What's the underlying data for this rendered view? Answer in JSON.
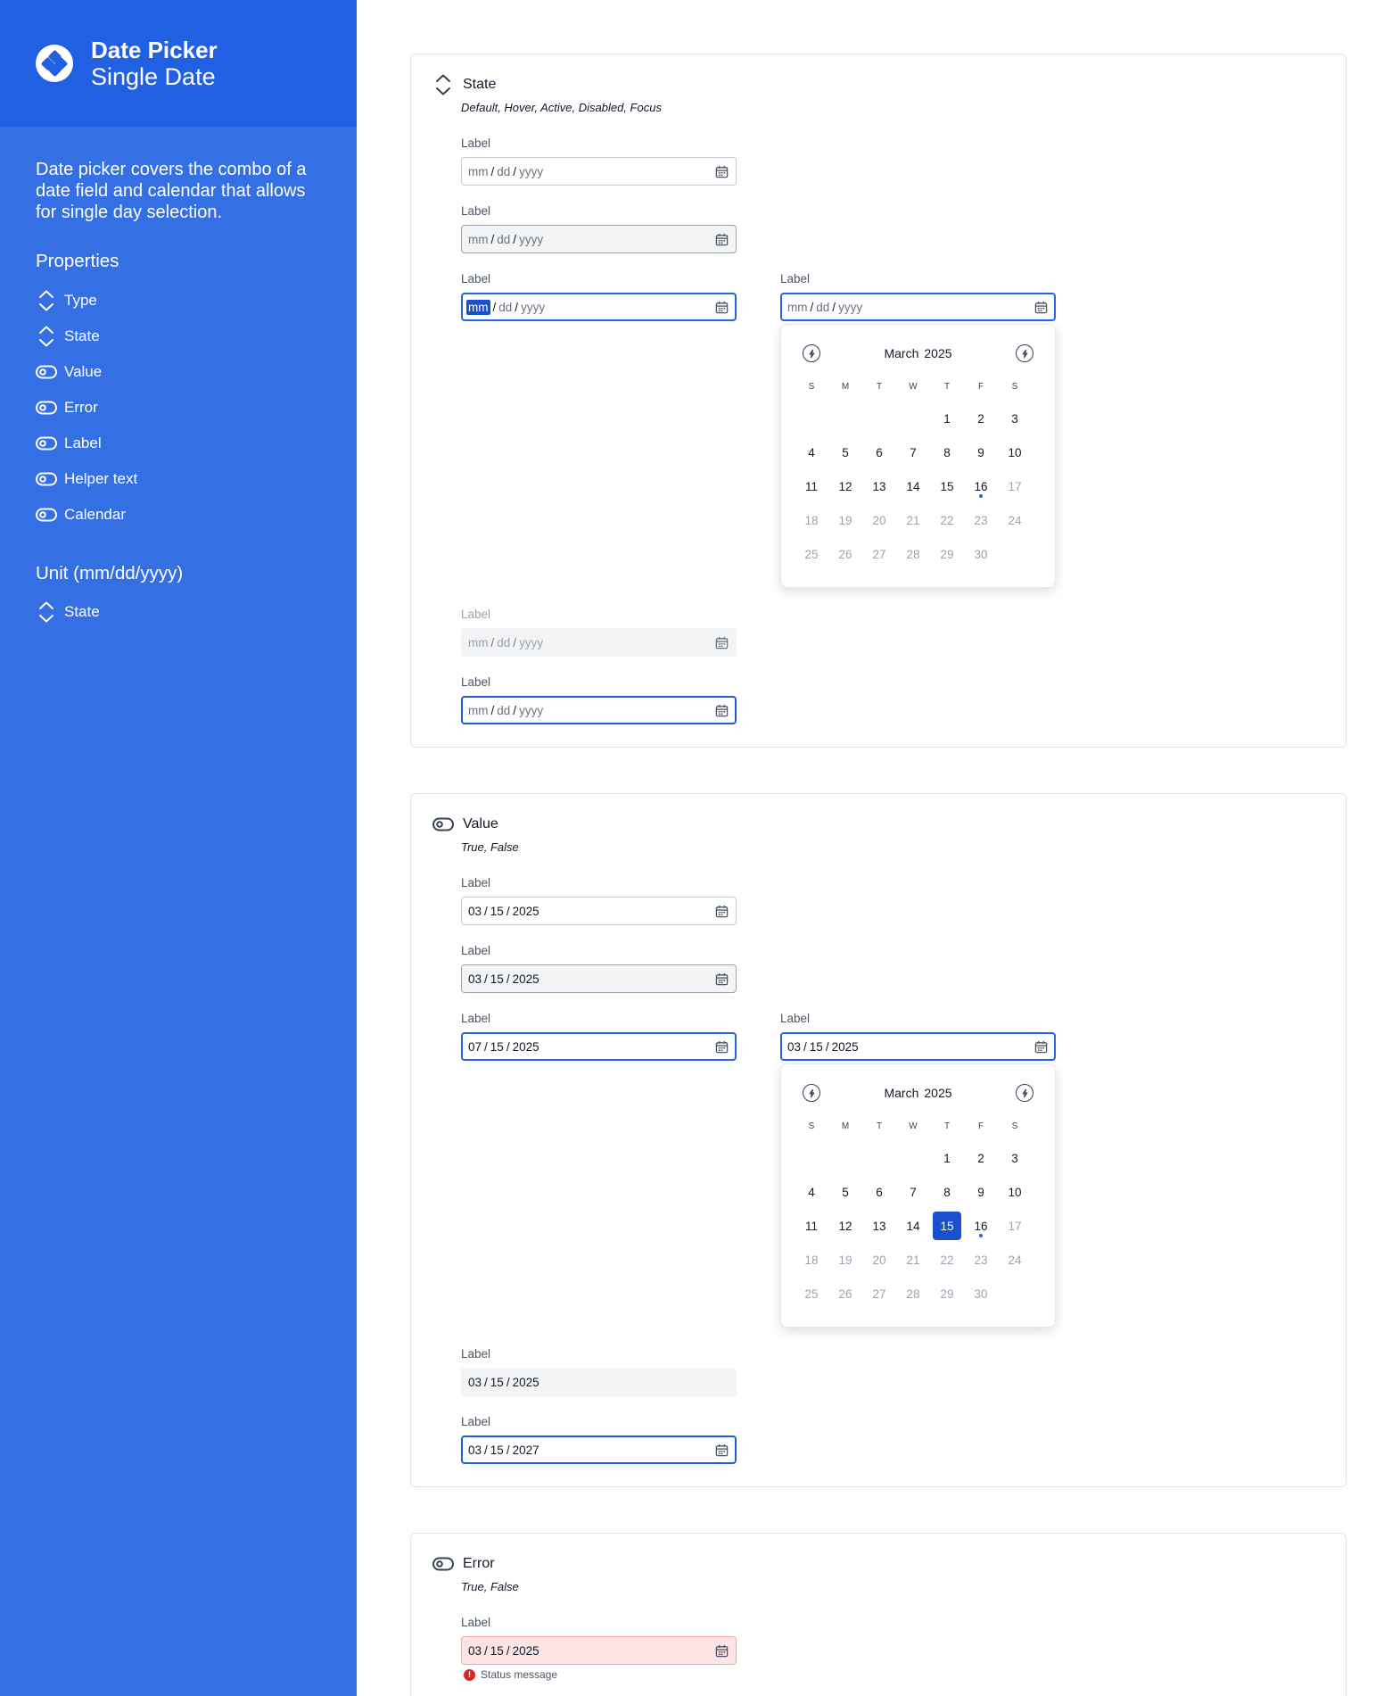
{
  "sidebar": {
    "title": "Date Picker",
    "subtitle": "Single Date",
    "description": "Date picker covers the combo of a date field and calendar that allows for single day selection.",
    "properties_heading": "Properties",
    "properties": [
      {
        "label": "Type",
        "icon": "chevron-up-down-icon"
      },
      {
        "label": "State",
        "icon": "chevron-up-down-icon"
      },
      {
        "label": "Value",
        "icon": "toggle-icon"
      },
      {
        "label": "Error",
        "icon": "toggle-icon"
      },
      {
        "label": "Label",
        "icon": "toggle-icon"
      },
      {
        "label": "Helper text",
        "icon": "toggle-icon"
      },
      {
        "label": "Calendar",
        "icon": "toggle-icon"
      }
    ],
    "unit_heading": "Unit (mm/dd/yyyy)",
    "unit_properties": [
      {
        "label": "State",
        "icon": "chevron-up-down-icon"
      }
    ]
  },
  "sections": {
    "state": {
      "title": "State",
      "subtitle": "Default, Hover, Active, Disabled, Focus",
      "fields": [
        {
          "label": "Label",
          "mm": "mm",
          "dd": "dd",
          "yyyy": "yyyy"
        },
        {
          "label": "Label",
          "mm": "mm",
          "dd": "dd",
          "yyyy": "yyyy"
        },
        {
          "label": "Label",
          "mm": "mm",
          "dd": "dd",
          "yyyy": "yyyy"
        },
        {
          "label": "Label",
          "mm": "mm",
          "dd": "dd",
          "yyyy": "yyyy"
        },
        {
          "label": "Label",
          "mm": "mm",
          "dd": "dd",
          "yyyy": "yyyy"
        },
        {
          "label": "Label",
          "mm": "mm",
          "dd": "dd",
          "yyyy": "yyyy"
        }
      ]
    },
    "value": {
      "title": "Value",
      "subtitle": "True, False",
      "fields": [
        {
          "label": "Label",
          "mm": "03",
          "dd": "15",
          "yyyy": "2025"
        },
        {
          "label": "Label",
          "mm": "03",
          "dd": "15",
          "yyyy": "2025"
        },
        {
          "label": "Label",
          "mm": "07",
          "dd": "15",
          "yyyy": "2025"
        },
        {
          "label": "Label",
          "mm": "03",
          "dd": "15",
          "yyyy": "2025"
        },
        {
          "label": "Label",
          "mm": "03",
          "dd": "15",
          "yyyy": "2025"
        },
        {
          "label": "Label",
          "mm": "03",
          "dd": "15",
          "yyyy": "2027"
        }
      ]
    },
    "error": {
      "title": "Error",
      "subtitle": "True, False",
      "fields": [
        {
          "label": "Label",
          "mm": "03",
          "dd": "15",
          "yyyy": "2025",
          "status": "Status message"
        }
      ]
    }
  },
  "calendar": {
    "month": "March",
    "year": "2025",
    "weekdays": [
      "S",
      "M",
      "T",
      "W",
      "T",
      "F",
      "S"
    ],
    "leading_blanks": 4,
    "days": [
      "1",
      "2",
      "3",
      "4",
      "5",
      "6",
      "7",
      "8",
      "9",
      "10",
      "11",
      "12",
      "13",
      "14",
      "15",
      "16",
      "17",
      "18",
      "19",
      "20",
      "21",
      "22",
      "23",
      "24",
      "25",
      "26",
      "27",
      "28",
      "29",
      "30"
    ],
    "today": "16",
    "last_enabled_day": "16",
    "selected_day": "15"
  },
  "colors": {
    "sidebar_bg": "#356fe4",
    "sidebar_header_bg": "#2160e2",
    "accent": "#2563eb",
    "selected": "#1a4fd0",
    "error_bg": "#fde4e4",
    "error_icon": "#dc2626"
  }
}
